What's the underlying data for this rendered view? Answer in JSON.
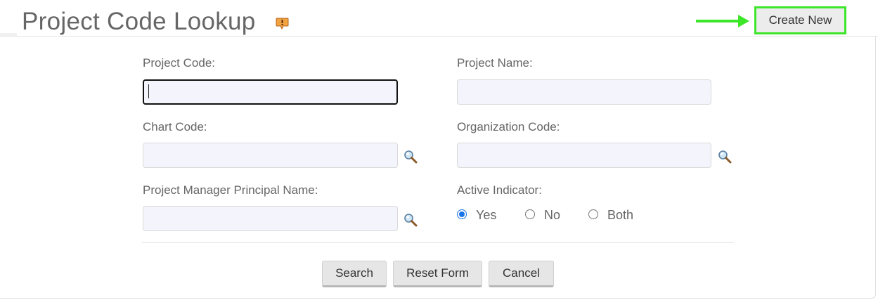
{
  "header": {
    "title": "Project Code Lookup",
    "help_icon": "help-balloon-icon",
    "create_new_label": "Create New",
    "highlight_color": "#3ee62a"
  },
  "form": {
    "project_code": {
      "label": "Project Code:",
      "value": ""
    },
    "project_name": {
      "label": "Project Name:",
      "value": ""
    },
    "chart_code": {
      "label": "Chart Code:",
      "value": ""
    },
    "organization_code": {
      "label": "Organization Code:",
      "value": ""
    },
    "project_manager": {
      "label": "Project Manager Principal Name:",
      "value": ""
    },
    "active_indicator": {
      "label": "Active Indicator:",
      "options": [
        "Yes",
        "No",
        "Both"
      ],
      "selected": "Yes"
    },
    "lookup_icon": "magnifier-icon"
  },
  "actions": {
    "search_label": "Search",
    "reset_label": "Reset Form",
    "cancel_label": "Cancel"
  }
}
